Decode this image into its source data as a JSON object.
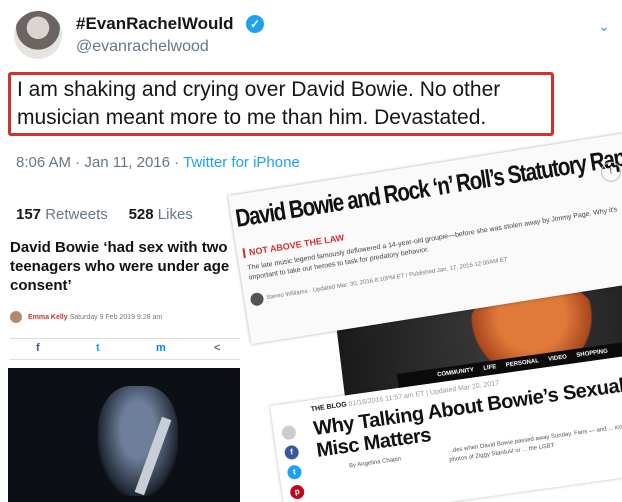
{
  "tweet": {
    "display_name": "#EvanRachelWould",
    "handle": "@evanrachelwood",
    "verified_glyph": "✓",
    "text": "I am shaking and crying over David Bowie. No other musician meant more to me than him. Devastated.",
    "time": "8:06 AM · Jan 11, 2016 · ",
    "source": "Twitter for iPhone",
    "retweets_count": "157",
    "retweets_label": "Retweets",
    "likes_count": "528",
    "likes_label": "Likes",
    "icons": {
      "menu": "chevron-down-icon",
      "verified": "verified-badge-icon"
    }
  },
  "left_article": {
    "headline": "David Bowie ‘had sex with two teenagers who were under age consent’",
    "author": "Emma Kelly",
    "date": "Saturday 9 Feb 2019 9:28 am",
    "share_icons": [
      "f",
      "t",
      "m",
      "<"
    ]
  },
  "rolling_stone": {
    "title": "David Bowie and Rock ‘n’ Roll’s Statutory Rape Problem",
    "tag": "NOT ABOVE THE LAW",
    "dek": "The late music legend famously deflowered a 14-year-old groupie—before she was stolen away by Jimmy Page. Why it's important to take our heroes to task for predatory behavior.",
    "byline": "Stereo Williams · Updated Mar. 30, 2016 8:10PM ET / Published Jan. 17, 2016 12:00AM ET",
    "share_f": "f",
    "share_t": "y"
  },
  "huffpost": {
    "nav": "COMMUNITY LIFE PERSONAL VIDEO SHOPPING",
    "section": "THE BLOG",
    "section_date": "01/18/2016 11:57 am ET | Updated Mar 20, 2017",
    "headline": "Why Talking About Bowie’s Sexual Misc Matters",
    "byline": "By Angelina Chapin",
    "body": "...des when David Bowie passed away Sunday. Fans — and ... iconic photos of Ziggy Stardust or ... the LGBT",
    "icons": [
      "f",
      "t",
      "p"
    ]
  }
}
